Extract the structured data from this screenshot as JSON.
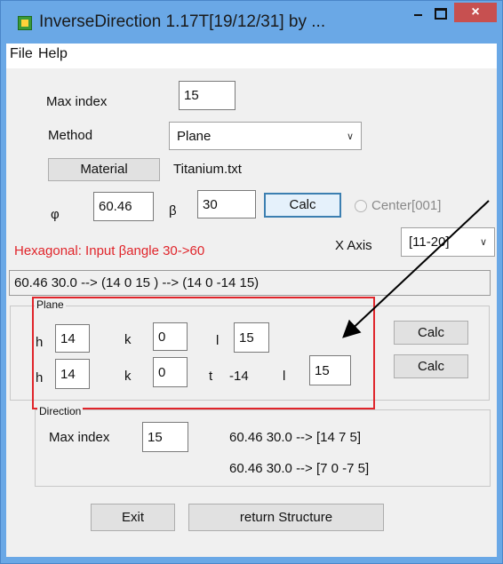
{
  "window": {
    "title": "InverseDirection 1.17T[19/12/31] by ...",
    "close_symbol": "×"
  },
  "menu": [
    "File",
    "Help"
  ],
  "form": {
    "max_index_label": "Max index",
    "max_index_value": "15",
    "method_label": "Method",
    "method_value": "Plane",
    "material_button": "Material",
    "material_file": "Titanium.txt",
    "phi_label": "φ",
    "phi_value": "60.46",
    "beta_label": "β",
    "beta_value": "30",
    "calc_button": "Calc",
    "center_radio_label": "Center[001]",
    "hexagonal_warning": "Hexagonal: Input βangle  30->60",
    "x_axis_label": "X Axis",
    "x_axis_value": "[11-20]",
    "result_text": "60.46 30.0 --> (14 0 15 ) --> (14 0 -14 15)"
  },
  "plane": {
    "title": "Plane",
    "row1": {
      "h_label": "h",
      "h_value": "14",
      "k_label": "k",
      "k_value": "0",
      "l_label": "l",
      "l_value": "15",
      "calc": "Calc"
    },
    "row2": {
      "h_label": "h",
      "h_value": "14",
      "k_label": "k",
      "k_value": "0",
      "t_label": "t",
      "t_value": "-14",
      "l_label": "l",
      "l_value": "15",
      "calc": "Calc"
    }
  },
  "direction": {
    "title": "Direction",
    "max_index_label": "Max index",
    "max_index_value": "15",
    "result1": "60.46 30.0 --> [14 7 5]",
    "result2": "60.46 30.0 --> [7 0 -7 5]"
  },
  "footer": {
    "exit_button": "Exit",
    "return_button": "return Structure"
  },
  "colors": {
    "title_bar": "#6aa8e6",
    "close_button": "#c75050",
    "warning_text": "#e0252b",
    "highlight_box": "#e0252b",
    "annotation_arrow": "#000000"
  },
  "icons": [
    "app-icon",
    "minimize-icon",
    "maximize-icon",
    "close-icon",
    "chevron-down-icon",
    "radio-icon",
    "arrow-annotation-icon"
  ]
}
